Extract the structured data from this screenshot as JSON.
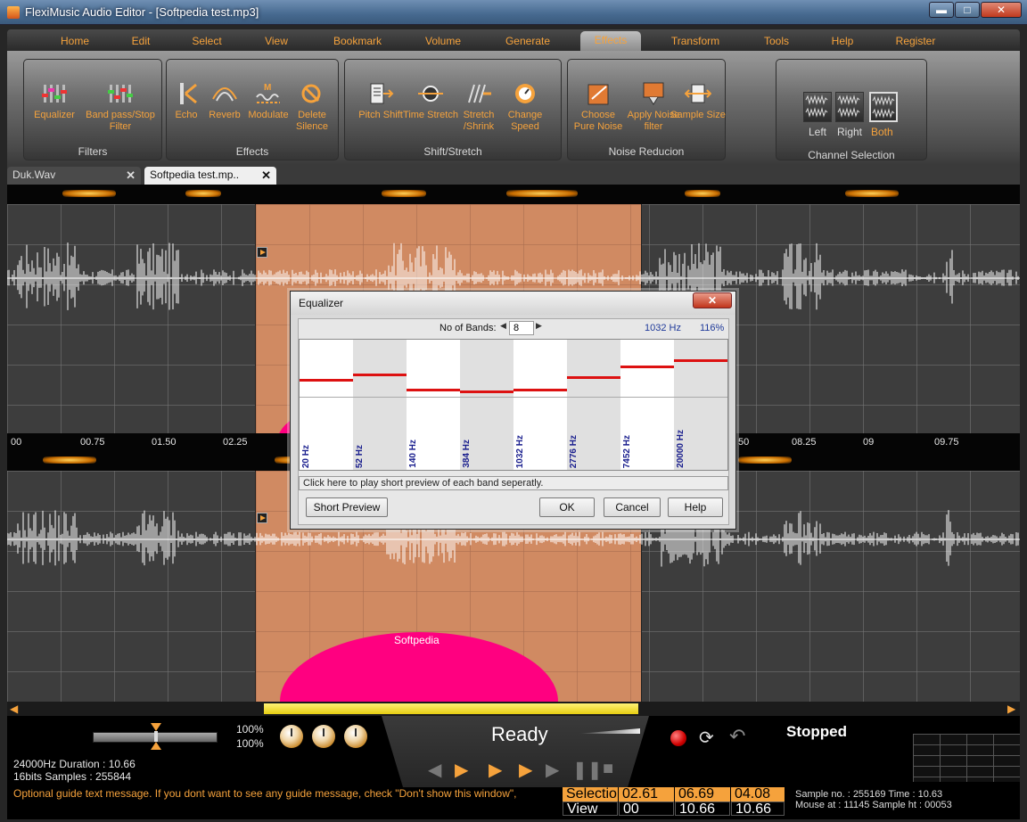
{
  "window": {
    "title": "FlexiMusic Audio Editor - [Softpedia test.mp3]",
    "buttons": {
      "minimize": "▬",
      "maximize": "□",
      "close": "✕"
    }
  },
  "menu": [
    "Home",
    "Edit",
    "Select",
    "View",
    "Bookmark",
    "Volume",
    "Generate",
    "Effects",
    "Transform",
    "Tools",
    "Help",
    "Register"
  ],
  "active_menu": "Effects",
  "ribbon": {
    "filters": {
      "label": "Filters",
      "tools": [
        "Equalizer",
        "Band pass/Stop Filter"
      ]
    },
    "effects": {
      "label": "Effects",
      "tools": [
        "Echo",
        "Reverb",
        "Modulate",
        "Delete Silence"
      ]
    },
    "shift": {
      "label": "Shift/Stretch",
      "tools": [
        "Pitch Shift",
        "Time Stretch",
        "Stretch /Shrink",
        "Change Speed"
      ]
    },
    "noise": {
      "label": "Noise Reducion",
      "tools": [
        "Choose Pure Noise",
        "Apply Noise filter",
        "Sample Size"
      ]
    },
    "channel": {
      "label": "Channel Selection",
      "options": [
        "Left",
        "Right",
        "Both"
      ],
      "selected": "Both"
    }
  },
  "tabs": [
    {
      "label": "Duk.Wav",
      "close": "✕",
      "active": false
    },
    {
      "label": "Softpedia test.mp..",
      "close": "✕",
      "active": true
    }
  ],
  "ruler_top": [
    "00",
    "00.75",
    "01.50",
    "02.25",
    "50",
    "08.25",
    "09",
    "09.75"
  ],
  "wave_watermark": "Softpedia",
  "equalizer": {
    "title": "Equalizer",
    "close": "✕",
    "bands_label": "No of Bands:",
    "bands_value": "8",
    "freq_readout": "1032 Hz",
    "gain_readout": "116%",
    "bands": [
      {
        "freq": "20 Hz",
        "level": 0.28
      },
      {
        "freq": "52 Hz",
        "level": 0.36
      },
      {
        "freq": "140 Hz",
        "level": 0.12
      },
      {
        "freq": "384 Hz",
        "level": 0.1
      },
      {
        "freq": "1032 Hz",
        "level": 0.12
      },
      {
        "freq": "2776 Hz",
        "level": 0.32
      },
      {
        "freq": "7452 Hz",
        "level": 0.48
      },
      {
        "freq": "20000 Hz",
        "level": 0.58
      }
    ],
    "hint": "Click here to play short preview of each band seperatly.",
    "buttons": {
      "preview": "Short Preview",
      "ok": "OK",
      "cancel": "Cancel",
      "help": "Help"
    }
  },
  "transport": {
    "vol_left": "100%",
    "vol_right": "100%",
    "status": "Ready",
    "play_state": "Stopped",
    "info_line1": "24000Hz  Duration : 10.66",
    "info_line2": "16bits  Samples : 255844",
    "guide": "Optional guide text message. If you dont want to see any guide message, check \"Don't show this window\",",
    "selection": {
      "label": "Selection",
      "start": "02.61",
      "end": "06.69",
      "length": "04.08"
    },
    "view": {
      "label": "View",
      "start": "00",
      "end": "10.66",
      "length": "10.66"
    },
    "sample_line1": "Sample no. : 255169  Time : 10.63",
    "sample_line2": "Mouse at : 11145  Sample ht : 00053"
  },
  "colors": {
    "accent": "#f5a23c",
    "selection": "#d08a62",
    "eq_line": "#dd1111",
    "magenta": "#ff0080"
  }
}
